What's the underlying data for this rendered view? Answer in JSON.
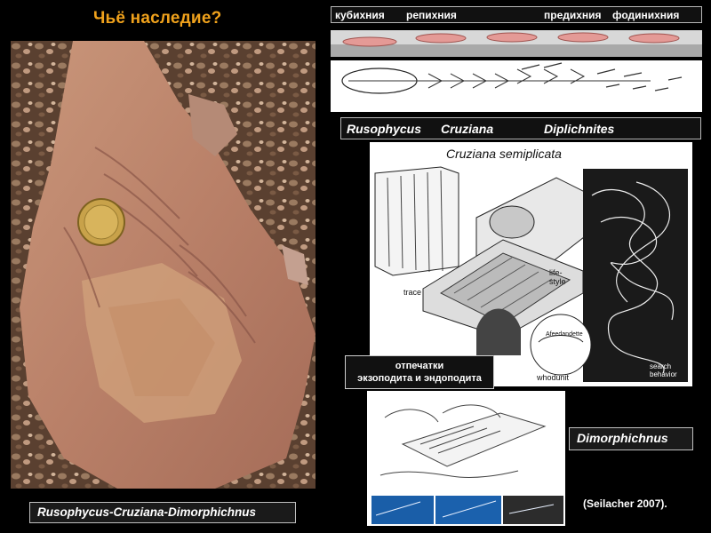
{
  "title": "Чьё наследие?",
  "behaviors": [
    "кубихния",
    "репихния",
    "предихния",
    "фодинихния"
  ],
  "genera": [
    "Rusophycus",
    "Cruziana",
    "Diplichnites"
  ],
  "diagram": {
    "title": "Cruziana semiplicata",
    "labels": {
      "trace": "trace",
      "lifestyle": "life-\nstyle",
      "whodunit": "whodunit",
      "search": "search\nbehavior",
      "afeeding": "Afeedandette"
    }
  },
  "callout": {
    "line1": "отпечатки",
    "line2": "экзоподита и эндоподита"
  },
  "dimorphichnus": "Dimorphichnus",
  "bottom_label": "Rusophycus-Cruziana-Dimorphichnus",
  "credit": "(Seilacher 2007)."
}
